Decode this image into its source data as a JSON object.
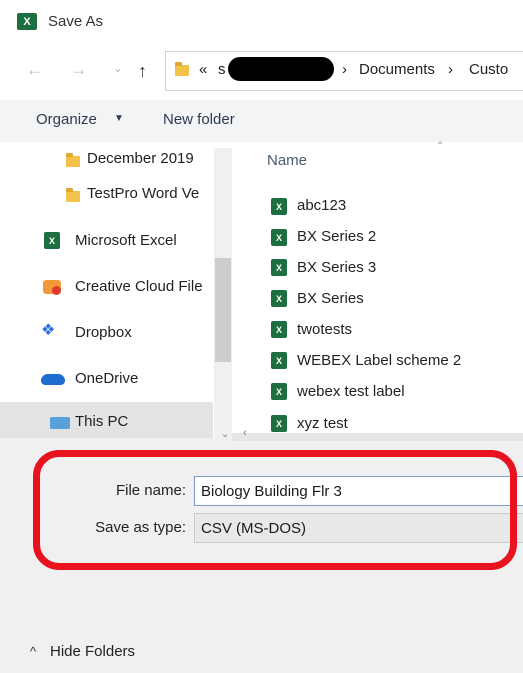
{
  "window": {
    "title": "Save As"
  },
  "nav": {
    "path_prefix": "«",
    "path_partial": "s",
    "crumb_sep": "›",
    "crumbs": [
      "Documents",
      "Custo"
    ]
  },
  "toolbar": {
    "organize_label": "Organize",
    "new_folder_label": "New folder"
  },
  "sidebar": {
    "items": [
      {
        "label": "December 2019",
        "icon": "folder-icon"
      },
      {
        "label": "TestPro Word Ve",
        "icon": "folder-icon"
      },
      {
        "label": "Microsoft Excel",
        "icon": "excel-icon"
      },
      {
        "label": "Creative Cloud File",
        "icon": "creative-cloud-icon"
      },
      {
        "label": "Dropbox",
        "icon": "dropbox-icon"
      },
      {
        "label": "OneDrive",
        "icon": "onedrive-icon"
      },
      {
        "label": "This PC",
        "icon": "computer-icon",
        "selected": true
      }
    ]
  },
  "files": {
    "column_name": "Name",
    "items": [
      "abc123",
      "BX Series 2",
      "BX Series 3",
      "BX Series",
      "twotests",
      "WEBEX Label scheme 2",
      "webex test label",
      "xyz test"
    ]
  },
  "form": {
    "file_name_label": "File name:",
    "file_name_value": "Biology Building Flr 3",
    "save_type_label": "Save as type:",
    "save_type_value": "CSV (MS-DOS)"
  },
  "footer": {
    "hide_folders_label": "Hide Folders"
  },
  "colors": {
    "highlight_border": "#e8131f",
    "excel_green": "#1d6f42"
  }
}
